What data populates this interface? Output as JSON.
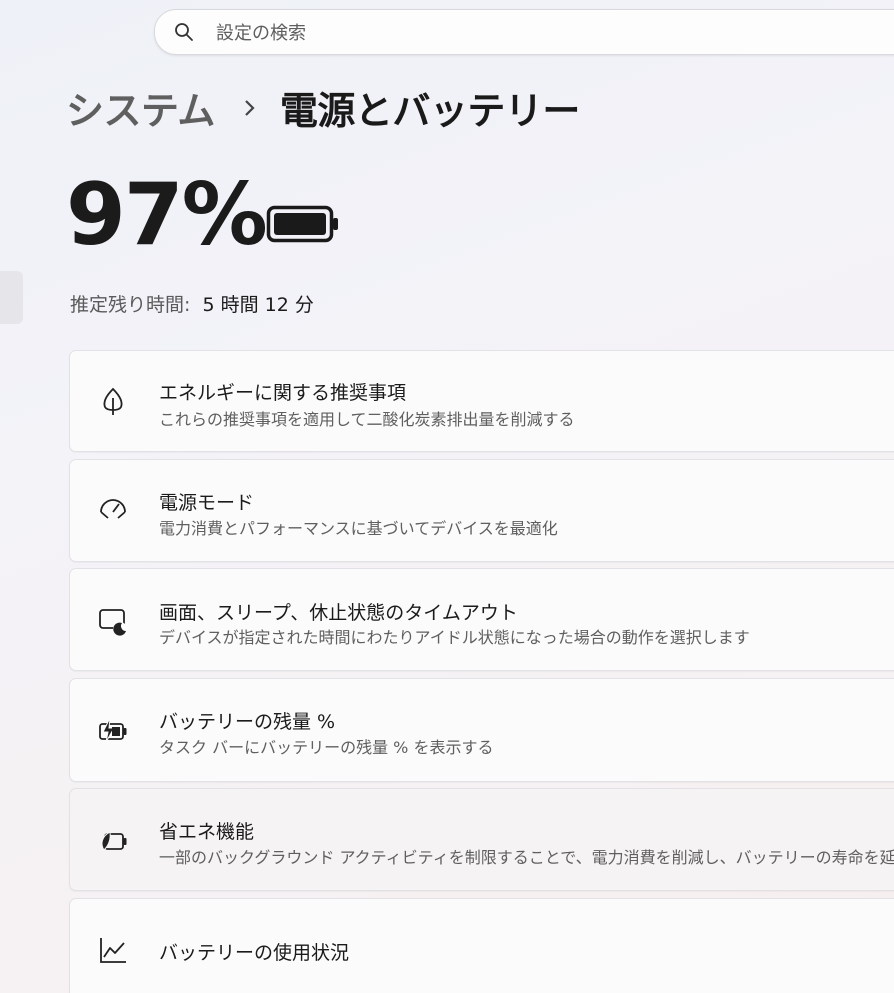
{
  "search": {
    "placeholder": "設定の検索",
    "icon": "search-icon"
  },
  "breadcrumb": {
    "parent": "システム",
    "current": "電源とバッテリー"
  },
  "battery": {
    "percent_text": "97%",
    "level": 0.97,
    "icon": "battery-full-icon"
  },
  "estimate": {
    "label": "推定残り時間:",
    "value": "5 時間 12 分"
  },
  "cards": [
    {
      "icon": "leaf-icon",
      "title": "エネルギーに関する推奨事項",
      "desc": "これらの推奨事項を適用して二酸化炭素排出量を削減する"
    },
    {
      "icon": "gauge-icon",
      "title": "電源モード",
      "desc": "電力消費とパフォーマンスに基づいてデバイスを最適化"
    },
    {
      "icon": "screen-sleep-icon",
      "title": "画面、スリープ、休止状態のタイムアウト",
      "desc": "デバイスが指定された時間にわたりアイドル状態になった場合の動作を選択します"
    },
    {
      "icon": "battery-charging-icon",
      "title": "バッテリーの残量 %",
      "desc": "タスク バーにバッテリーの残量 % を表示する"
    },
    {
      "icon": "battery-saver-icon",
      "title": "省エネ機能",
      "desc": "一部のバックグラウンド アクティビティを制限することで、電力消費を削減し、バッテリーの寿命を延ばす"
    },
    {
      "icon": "chart-icon",
      "title": "バッテリーの使用状況"
    }
  ]
}
